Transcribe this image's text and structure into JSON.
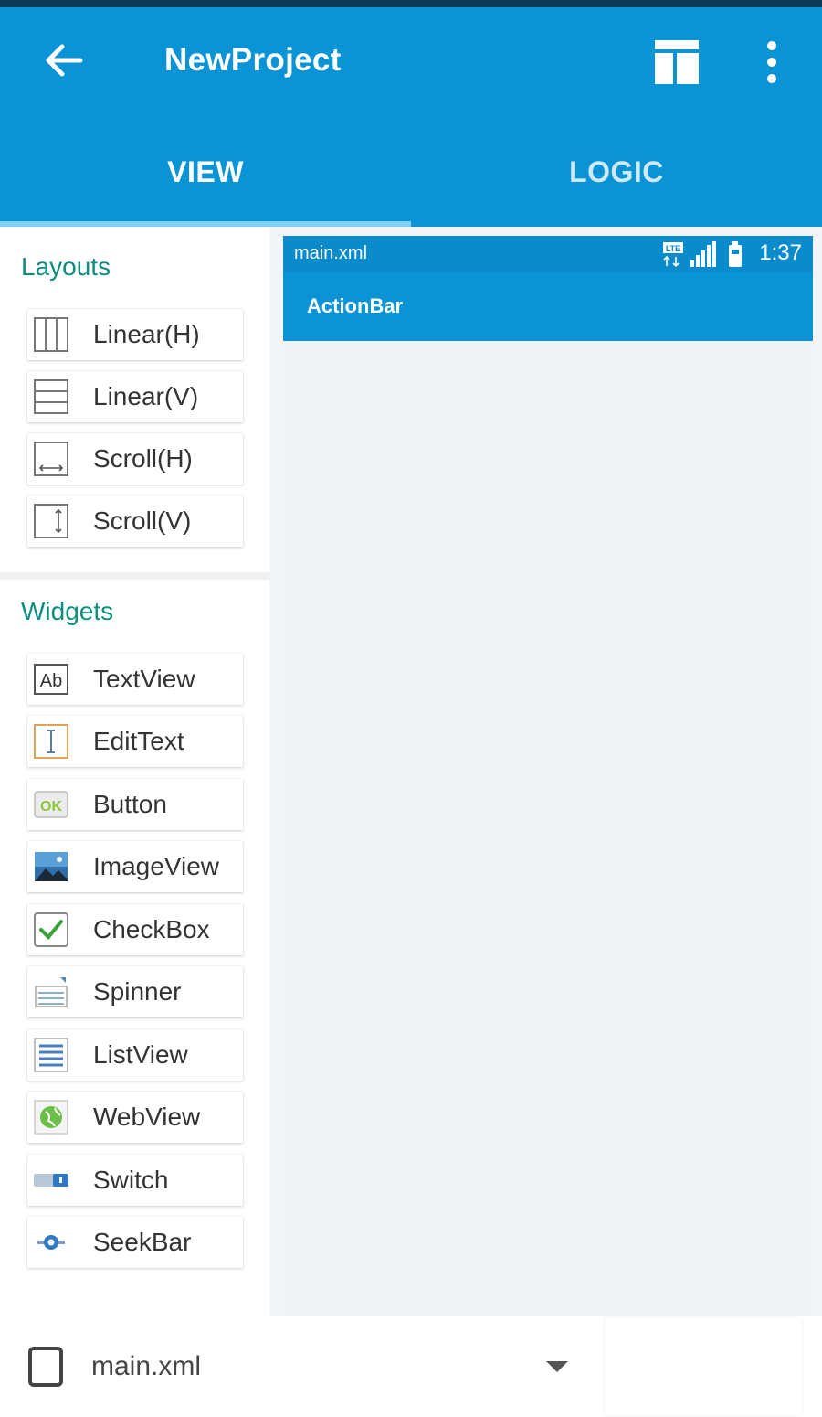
{
  "appbar": {
    "title": "NewProject"
  },
  "tabs": [
    {
      "label": "VIEW"
    },
    {
      "label": "LOGIC"
    }
  ],
  "sidebar": {
    "layouts_title": "Layouts",
    "layouts": [
      {
        "label": "Linear(H)",
        "icon": "linear-h-icon"
      },
      {
        "label": "Linear(V)",
        "icon": "linear-v-icon"
      },
      {
        "label": "Scroll(H)",
        "icon": "scroll-h-icon"
      },
      {
        "label": "Scroll(V)",
        "icon": "scroll-v-icon"
      }
    ],
    "widgets_title": "Widgets",
    "widgets": [
      {
        "label": "TextView",
        "icon": "textview-icon"
      },
      {
        "label": "EditText",
        "icon": "edittext-icon"
      },
      {
        "label": "Button",
        "icon": "button-icon"
      },
      {
        "label": "ImageView",
        "icon": "imageview-icon"
      },
      {
        "label": "CheckBox",
        "icon": "checkbox-icon"
      },
      {
        "label": "Spinner",
        "icon": "spinner-icon"
      },
      {
        "label": "ListView",
        "icon": "listview-icon"
      },
      {
        "label": "WebView",
        "icon": "webview-icon"
      },
      {
        "label": "Switch",
        "icon": "switch-icon"
      },
      {
        "label": "SeekBar",
        "icon": "seekbar-icon"
      }
    ]
  },
  "preview": {
    "file": "main.xml",
    "time": "1:37",
    "actionbar": "ActionBar"
  },
  "bottom": {
    "selected_file": "main.xml"
  },
  "icon_text": {
    "textview": "Ab",
    "button": "OK",
    "lte": "LTE"
  },
  "colors": {
    "primary": "#0a94d6",
    "section_title": "#0d8e7e",
    "tab_indicator": "#7fd0f5"
  }
}
